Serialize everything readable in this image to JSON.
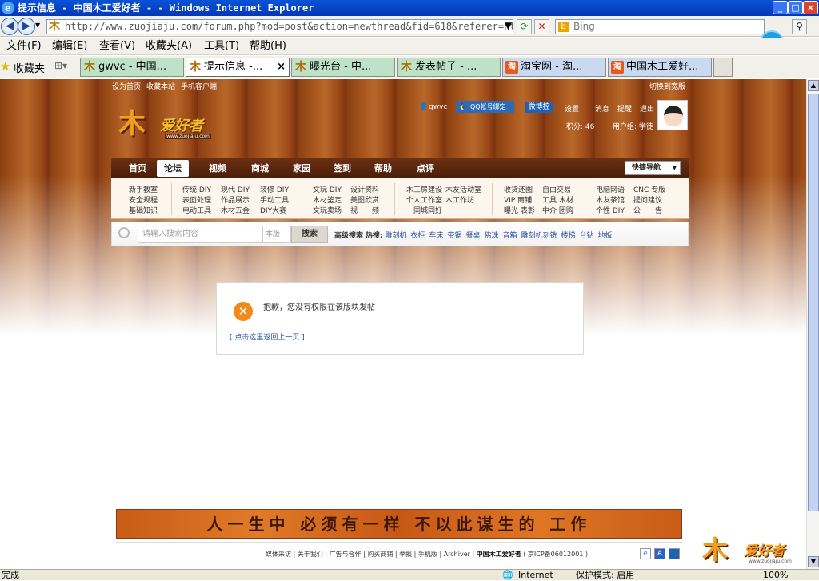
{
  "window": {
    "title": "提示信息 - 中国木工爱好者 - - Windows Internet Explorer"
  },
  "address": {
    "url": "http://www.zuojiaju.com/forum.php?mod=post&action=newthread&fid=618&referer=http",
    "search_engine": "Bing"
  },
  "menu": [
    "文件(F)",
    "编辑(E)",
    "查看(V)",
    "收藏夹(A)",
    "工具(T)",
    "帮助(H)"
  ],
  "favorites": {
    "label": "收藏夹"
  },
  "tabs": [
    {
      "label": "gwvc - 中国...",
      "icon": "mu-icon"
    },
    {
      "label": "提示信息 -...",
      "icon": "mu-icon",
      "close": "×"
    },
    {
      "label": "曝光台 - 中...",
      "icon": "mu-icon"
    },
    {
      "label": "发表帖子 - ...",
      "icon": "mu-icon"
    },
    {
      "label": "淘宝网 - 淘...",
      "icon": "taobao-icon"
    },
    {
      "label": "中国木工爱好...",
      "icon": "taobao-icon"
    }
  ],
  "site": {
    "top_links": [
      "设为首页",
      "收藏本站",
      "手机客户端"
    ],
    "switch_link": "切换到宽版",
    "logo_text": "爱好者",
    "logo_url": "www.zuojiaju.com",
    "user": {
      "name": "gwvc",
      "qq_bind": "QQ帐号绑定",
      "weibo": "微博控",
      "settings": "设置",
      "messages": "消息",
      "reminders": "提醒",
      "logout": "退出",
      "points": "积分: 46",
      "usergroup": "用户组: 学徒"
    },
    "nav": [
      "首页",
      "论坛",
      "视频",
      "商城",
      "家园",
      "签到",
      "帮助",
      "点评"
    ],
    "quick_nav": "快捷导航",
    "subnav_cols": [
      "新手教室\n安全规程\n基础知识",
      "传统 DIY\n表面处理\n电动工具",
      "现代 DIY\n作品展示\n木材五金",
      "装修 DIY\n手动工具\nDIY大赛",
      "文玩 DIY\n木材鉴定\n文玩卖场",
      "设计资料\n美图欣赏\n视　　频",
      "木工房建设\n个人工作室\n　同城同好",
      "木友活动室\n木工作坊",
      "收货还图\nVIP 商铺\n曝光 表彰",
      "自由交易\n工具 木材\n中介 团购",
      "电脑网语\n木友茶馆\n个性 DIY",
      "CNC 专版\n提问建议\n公　　告"
    ],
    "search": {
      "placeholder": "请输入搜索内容",
      "scope": "本版",
      "button": "搜索",
      "advanced": "高级搜索",
      "hot_label": "热搜:",
      "hot": [
        "雕刻机",
        "衣柜",
        "车床",
        "带锯",
        "餐桌",
        "佛珠",
        "音箱",
        "雕刻机刻铣",
        "楼梯",
        "台钻",
        "地板"
      ]
    },
    "message": {
      "text": "抱歉，您没有权限在该版块发帖",
      "back": "[ 点击这里返回上一页 ]"
    },
    "banner": "人一生中 必须有一样 不以此谋生的 工作",
    "footer": {
      "links": [
        "媒体采访",
        "关于我们",
        "广告与合作",
        "购买商铺",
        "举报",
        "手机版",
        "Archiver"
      ],
      "site_name": "中国木工爱好者",
      "icp": "( 京ICP备06012001 )"
    }
  },
  "status": {
    "left": "完成",
    "zone": "Internet",
    "protected": "保护模式: 启用",
    "zoom": "100%"
  }
}
